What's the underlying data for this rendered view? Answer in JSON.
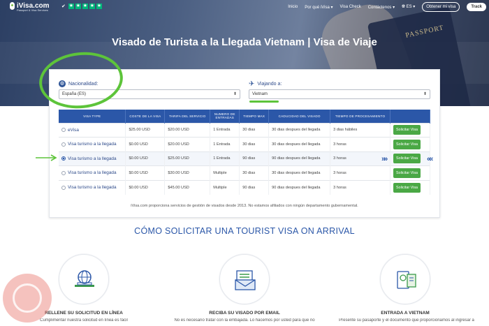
{
  "nav": {
    "brand": "iVisa.com",
    "tagline": "Passport & Visa Services",
    "links": [
      "Inicio",
      "Por qué iVisa",
      "Visa Check",
      "Contáctenos",
      "ES"
    ],
    "get_visa": "Obtener mi visa",
    "track": "Track"
  },
  "hero": {
    "title": "Visado de Turista a la Llegada Vietnam | Visa de Viaje",
    "deco_text": "PASSPORT"
  },
  "form": {
    "nationality_label": "Nacionalidad:",
    "nationality_value": "España (ES)",
    "travel_label": "Viajando a:",
    "travel_value": "Vietnam"
  },
  "table": {
    "headers": [
      "VISA TYPE",
      "COSTE DE LA VISA",
      "TARIFA DEL SERVICIO",
      "NUMERO DE ENTRADAS",
      "TIEMPO MAX",
      "CADUCIDAD DEL VISADO",
      "TIEMPO DE PROCESAMIENTO",
      ""
    ],
    "rows": [
      {
        "type": "eVisa",
        "cost": "$25.00 USD",
        "fee": "$20.00 USD",
        "entries": "1 Entrada",
        "max": "30 dias",
        "expiry": "30 dias despues del llegada",
        "processing": "3 dias hábiles",
        "action": "Solicitar Visa",
        "selected": false
      },
      {
        "type": "Visa turismo a la llegada",
        "cost": "$0.00 USD",
        "fee": "$20.00 USD",
        "entries": "1 Entrada",
        "max": "30 dias",
        "expiry": "30 dias despues del llegada",
        "processing": "3 horas",
        "action": "Solicitar Visa",
        "selected": false
      },
      {
        "type": "Visa turismo a la llegada",
        "cost": "$0.00 USD",
        "fee": "$25.00 USD",
        "entries": "1 Entrada",
        "max": "90 dias",
        "expiry": "90 dias despues del llegada",
        "processing": "3 horas",
        "action": "Solicitar Visa",
        "selected": true
      },
      {
        "type": "Visa turismo a la llegada",
        "cost": "$0.00 USD",
        "fee": "$30.00 USD",
        "entries": "Multiple",
        "max": "30 dias",
        "expiry": "30 dias despues del llegada",
        "processing": "3 horas",
        "action": "Solicitar Visa",
        "selected": false
      },
      {
        "type": "Visa turismo a la llegada",
        "cost": "$0.00 USD",
        "fee": "$45.00 USD",
        "entries": "Multiple",
        "max": "90 dias",
        "expiry": "90 dias despues del llegada",
        "processing": "3 horas",
        "action": "Solicitar Visa",
        "selected": false
      }
    ]
  },
  "disclaimer": "iVisa.com proporciona servicios de gestión de visados desde 2013. No estamos afiliados con ningún departamento gubernamental.",
  "how": {
    "title": "CÓMO SOLICITAR UNA TOURIST VISA ON ARRIVAL",
    "steps": [
      {
        "title": "RELLENE SU SOLICITUD EN LÍNEA",
        "text": "Cumplimentar nuestra solicitud en línea es fácil"
      },
      {
        "title": "RECIBA SU VISADO POR EMAIL",
        "text": "No es necesario tratar con la embajada. Lo hacemos por usted para que no"
      },
      {
        "title": "ENTRADA A VIETNAM",
        "text": "Presente su pasaporte y el documento que proporcionamos al ingresar a"
      }
    ]
  },
  "colors": {
    "primary": "#2b57a8",
    "accent_green": "#4aa845",
    "highlight": "#5dc43a"
  }
}
